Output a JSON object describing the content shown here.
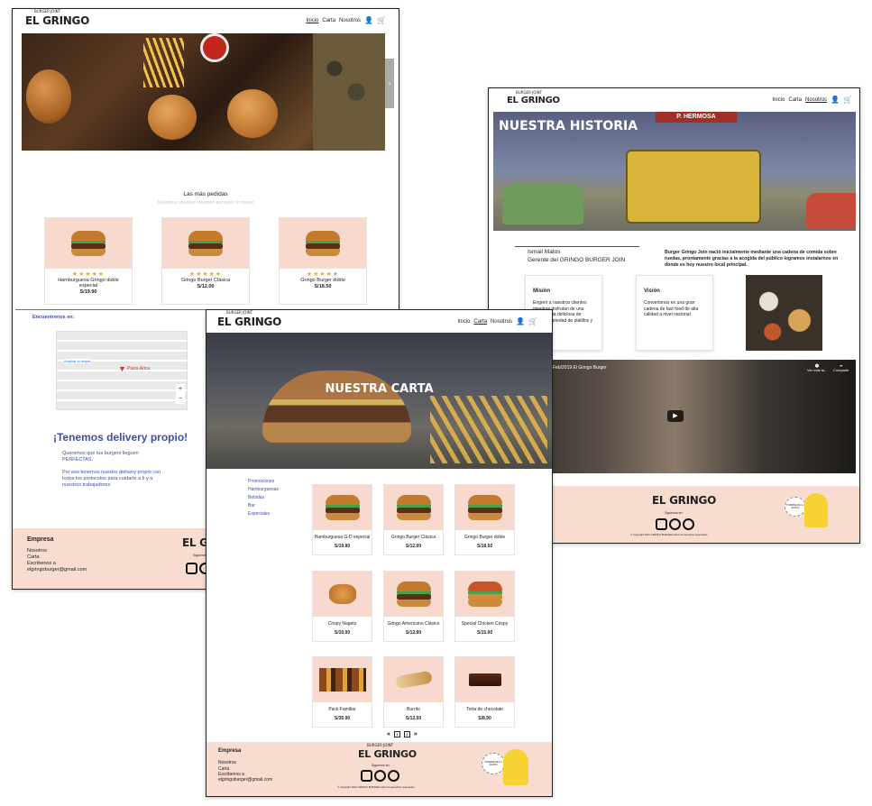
{
  "brand": {
    "logo": "EL GRINGO",
    "tag": "BURGER JOINT"
  },
  "nav": {
    "inicio": "Inicio",
    "carta": "Carta",
    "nosotros": "Nosotros"
  },
  "home": {
    "popular_title": "Las más pedidas",
    "popular_subtitle": "Nuestros clientes siempre escogen lo mejor",
    "products": [
      {
        "name": "Hamburguesa Gringo doble especial",
        "price": "S/19.90",
        "rating": 5
      },
      {
        "name": "Gringo Burger Clásica",
        "price": "S/12.00",
        "rating": 5
      },
      {
        "name": "Gringo Burger doble",
        "price": "S/18.50",
        "rating": 4
      }
    ],
    "map_label": "Encuentrenos en:",
    "map_link": "Ampliar el mapa",
    "map_place": "Plaza Arica",
    "delivery_title": "¡Tenemos delivery propio!",
    "delivery_p1": "Queremos que tus burgers lleguen PERFECTAS.",
    "delivery_p2": "Por eso tenemos nuestro delivery propio con todos los protocolos para cuidarte a ti y a nuestros trabajadores"
  },
  "footer": {
    "company_title": "Empresa",
    "links": [
      "Nosotros",
      "Carta",
      "Escribenos a"
    ],
    "email": "elgringoburger@gmail.com",
    "follow": "Siguenos en:",
    "copyright": "© Copyright 2021 GRINGO BURGER todos los derechos reservados",
    "sticker": "HOMBRE DE LA RAZÓN"
  },
  "about": {
    "hero_title": "NUESTRA HISTORIA",
    "manager_name": "Ismail Matos",
    "manager_role": "Gerente del GRINGO BURGER JOIN",
    "history": "Burger Gringo Join nació inicialmente mediante una cadena de comida sobre ruedas, prontamente gracias a la acogida del público logramos instalarnos en donde es hoy nuestro local principal.",
    "mission_title": "Misión",
    "mission_text": "Engreír a nuestros clientes mientras disfrutan de una experiencia deliciosa de nuestra variedad de platillos y productos",
    "vision_title": "Visión",
    "vision_text": "Convertirnos en una gran cadena de fast food de alta calidad a nivel nacional",
    "video_title": "Feb/2019 El Gringo Burger",
    "video_later": "Ver más ta...",
    "video_share": "Compartir",
    "store_sign": "P. HERMOSA"
  },
  "menu": {
    "hero_title": "NUESTRA CARTA",
    "categories": [
      "Promociones",
      "Hamburguesas",
      "Bebidas",
      "Bar",
      "Especiales"
    ],
    "products": [
      {
        "name": "Hamburguesa G-D especial",
        "price": "S/19.90"
      },
      {
        "name": "Gringo Burger Clásica",
        "price": "S/12.00"
      },
      {
        "name": "Gringo Burger doble",
        "price": "S/18.50"
      },
      {
        "name": "Crispy Nagets",
        "price": "S/10.00"
      },
      {
        "name": "Gringo Americano Clásico",
        "price": "S/12.90"
      },
      {
        "name": "Special Chicken Crispy",
        "price": "S/15.00"
      },
      {
        "name": "Pack Familiar",
        "price": "S/35.90"
      },
      {
        "name": "Burrito",
        "price": "S/12.50"
      },
      {
        "name": "Torta de chocolate",
        "price": "S/8.90"
      }
    ],
    "pages": [
      "1",
      "2"
    ]
  },
  "colors": {
    "accent_peach": "#f8dccf",
    "card_peach": "#f8d9cd",
    "link_blue": "#3d4fa8",
    "star": "#f5a623"
  }
}
